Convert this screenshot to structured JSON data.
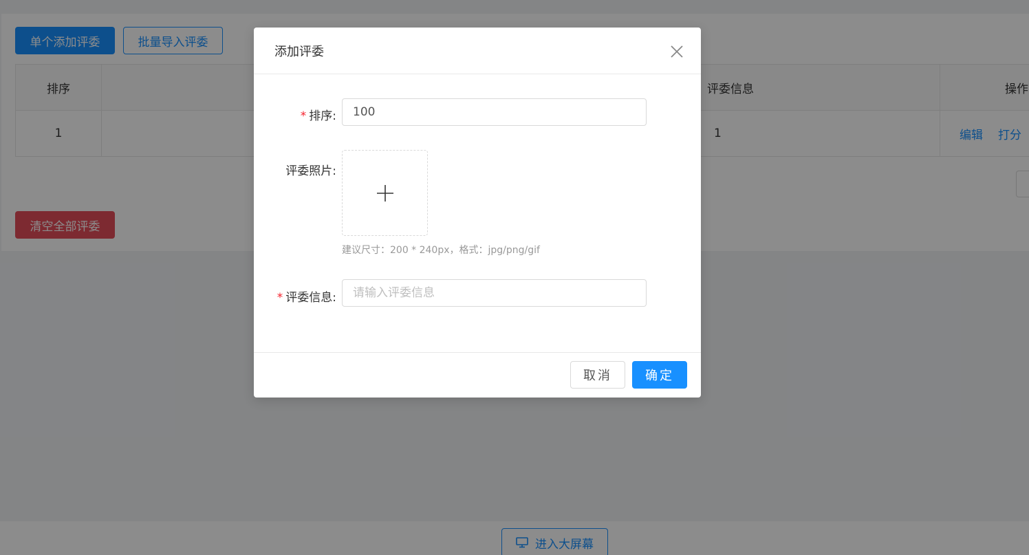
{
  "background": {
    "buttons": {
      "add_single": "单个添加评委",
      "batch_import": "批量导入评委",
      "clear_all": "清空全部评委",
      "big_screen": "进入大屏幕"
    },
    "table": {
      "headers": [
        "排序",
        "评委信息",
        "操作"
      ],
      "row": {
        "order": "1",
        "info": "1",
        "actions": [
          "编辑",
          "打分"
        ]
      }
    }
  },
  "modal": {
    "title": "添加评委",
    "fields": {
      "order": {
        "label": "排序:",
        "value": "100"
      },
      "photo": {
        "label": "评委照片:",
        "hint": "建议尺寸：200 * 240px，格式：jpg/png/gif"
      },
      "info": {
        "label": "评委信息:",
        "placeholder": "请输入评委信息"
      }
    },
    "required_mark": "*",
    "cancel": "取消",
    "ok": "确定"
  },
  "colors": {
    "primary": "#1890ff",
    "danger": "#e34d59",
    "required": "#f5222d"
  }
}
